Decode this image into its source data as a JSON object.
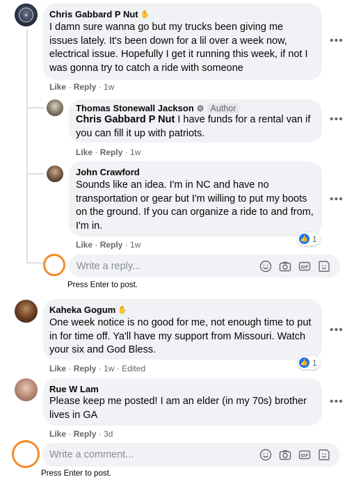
{
  "comments": [
    {
      "author": "Chris Gabbard P Nut",
      "text": "I damn sure wanna go but my trucks been giving me issues lately. It's been down for a lil over a week now, electrical issue. Hopefully I get it running this week, if not I was gonna try to catch a ride with someone",
      "like": "Like",
      "reply": "Reply",
      "time": "1w"
    },
    {
      "author": "Kaheka Gogum",
      "text": "One week notice is no good for me, not enough time to put in for time off. Ya'll have my support from Missouri. Watch your six and God Bless.",
      "like": "Like",
      "reply": "Reply",
      "time": "1w",
      "edited": "Edited",
      "reactions": "1"
    },
    {
      "author": "Rue W Lam",
      "text": "Please keep me posted! I am an elder (in my 70s) brother lives in GA",
      "like": "Like",
      "reply": "Reply",
      "time": "3d"
    }
  ],
  "replies": [
    {
      "author": "Thomas Stonewall Jackson",
      "author_tag": "Author",
      "mention": "Chris Gabbard P Nut",
      "text": " I have funds for a rental van if you can fill it up with patriots.",
      "like": "Like",
      "reply": "Reply",
      "time": "1w"
    },
    {
      "author": "John Crawford",
      "text": "Sounds like an idea. I'm in NC and have no transportation or gear but I'm willing to put my boots on the ground. If you can organize a ride to and from, I'm in.",
      "like": "Like",
      "reply": "Reply",
      "time": "1w",
      "reactions": "1"
    }
  ],
  "reply_box": {
    "placeholder": "Write a reply...",
    "hint": "Press Enter to post."
  },
  "comment_box": {
    "placeholder": "Write a comment...",
    "hint": "Press Enter to post."
  },
  "icons": [
    "emoji-icon",
    "camera-icon",
    "gif-icon",
    "sticker-icon"
  ],
  "colors": {
    "bubble": "#f0f2f5",
    "accent": "#1877f2",
    "highlight_ring": "#f28c28"
  }
}
